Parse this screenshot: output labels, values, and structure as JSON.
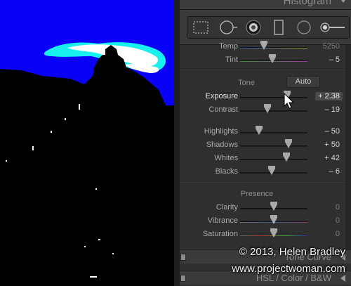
{
  "panel": {
    "histogram_title": "Histogram",
    "tools": [
      {
        "icon": "crop-overlay-icon"
      },
      {
        "icon": "spot-removal-icon"
      },
      {
        "icon": "red-eye-icon"
      },
      {
        "icon": "graduated-filter-icon"
      },
      {
        "icon": "radial-filter-icon"
      },
      {
        "icon": "adjustment-brush-icon"
      }
    ],
    "white_balance": {
      "temp": {
        "label": "Temp",
        "value": "5250",
        "level": 0.35
      },
      "tint": {
        "label": "Tint",
        "value": "– 5",
        "level": 0.48
      }
    },
    "tone": {
      "title": "Tone",
      "auto_label": "Auto",
      "sliders": [
        {
          "label": "Exposure",
          "value": "+ 2.38",
          "level": 0.7
        },
        {
          "label": "Contrast",
          "value": "– 19",
          "level": 0.41
        },
        {
          "label": "Highlights",
          "value": "– 50",
          "level": 0.28
        },
        {
          "label": "Shadows",
          "value": "+ 50",
          "level": 0.72
        },
        {
          "label": "Whites",
          "value": "+ 42",
          "level": 0.69
        },
        {
          "label": "Blacks",
          "value": "– 6",
          "level": 0.47
        }
      ]
    },
    "presence": {
      "title": "Presence",
      "sliders": [
        {
          "label": "Clarity",
          "value": "0",
          "level": 0.5
        },
        {
          "label": "Vibrance",
          "value": "0",
          "level": 0.5
        },
        {
          "label": "Saturation",
          "value": "0",
          "level": 0.5
        }
      ]
    },
    "tone_curve_title": "Tone Curve",
    "hsl_tabs": "HSL / Color / B&W"
  },
  "watermark": {
    "line1": "© 2013, Helen Bradley",
    "line2": "www.projectwoman.com"
  },
  "colors": {
    "sky_blue": "#0a00f5",
    "cloud_cyan": "#18f0f0",
    "cloud_white": "#ffffff",
    "panel_bg": "#2f2f2f"
  }
}
